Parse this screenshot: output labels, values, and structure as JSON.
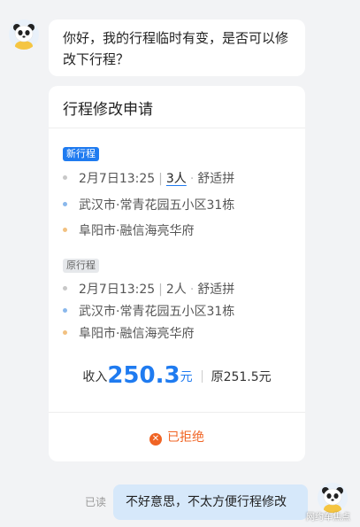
{
  "colors": {
    "accent": "#1f7bf0",
    "reject": "#f06424",
    "outgoing_bubble": "#d6e8fa"
  },
  "incoming_message": {
    "text": "你好，我的行程临时有变，是否可以修改下行程？"
  },
  "request_card": {
    "title": "行程修改申请",
    "new_trip": {
      "tag": "新行程",
      "datetime": "2月7日13:25",
      "passengers": "3人",
      "ride_type": "舒适拼",
      "origin": "武汉市·常青花园五小区31栋",
      "destination": "阜阳市·融信海亮华府"
    },
    "old_trip": {
      "tag": "原行程",
      "datetime": "2月7日13:25",
      "passengers": "2人",
      "ride_type": "舒适拼",
      "origin": "武汉市·常青花园五小区31栋",
      "destination": "阜阳市·融信海亮华府"
    },
    "income": {
      "label": "收入",
      "amount": "250.3",
      "unit": "元",
      "original": "原251.5元"
    },
    "status": {
      "icon": "close-circle-icon",
      "label": "已拒绝"
    }
  },
  "outgoing_message": {
    "read_status": "已读",
    "text": "不好意思，不太方便行程修改"
  },
  "watermark": "网约车焦点"
}
